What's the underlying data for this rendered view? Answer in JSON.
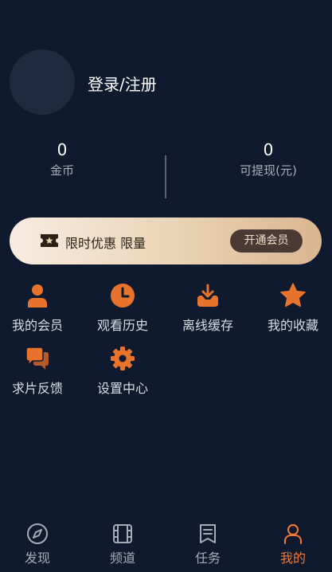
{
  "profile": {
    "login_label": "登录/注册"
  },
  "stats": {
    "coins": {
      "value": "0",
      "label": "金币"
    },
    "withdrawable": {
      "value": "0",
      "label": "可提现(元)"
    }
  },
  "vip": {
    "promo_text": "限时优惠 限量",
    "button_label": "开通会员",
    "icon": "ticket-icon"
  },
  "grid": [
    {
      "label": "我的会员",
      "icon": "user-icon"
    },
    {
      "label": "观看历史",
      "icon": "clock-icon"
    },
    {
      "label": "离线缓存",
      "icon": "download-icon"
    },
    {
      "label": "我的收藏",
      "icon": "star-icon"
    },
    {
      "label": "求片反馈",
      "icon": "chat-icon"
    },
    {
      "label": "设置中心",
      "icon": "gear-icon"
    }
  ],
  "bottom_nav": [
    {
      "label": "发现",
      "icon": "compass-icon",
      "active": false
    },
    {
      "label": "频道",
      "icon": "film-icon",
      "active": false
    },
    {
      "label": "任务",
      "icon": "task-icon",
      "active": false
    },
    {
      "label": "我的",
      "icon": "person-icon",
      "active": true
    }
  ],
  "colors": {
    "background": "#101a2e",
    "accent": "#f07a33",
    "icon_orange": "#e8732c",
    "banner_start": "#f9ece0",
    "banner_end": "#d9b690",
    "vip_button": "#4a3a33"
  }
}
